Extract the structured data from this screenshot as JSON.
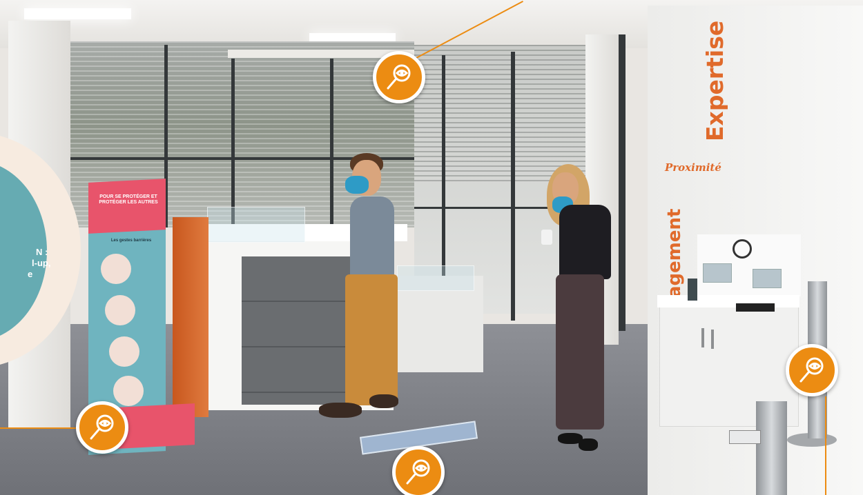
{
  "info_panel": {
    "lines": [
      "N :",
      "l-up,",
      "e"
    ],
    "colors": {
      "outer": "#f7ebe0",
      "inner": "#66abb2"
    }
  },
  "wall_words": {
    "vertical_main": "Expertise",
    "horizontal": "Proximité",
    "vertical_partial": "agement"
  },
  "rollup_banner": {
    "heading": "POUR SE PROTÉGER ET PROTÉGER LES AUTRES",
    "subheading": "Les gestes barrières"
  },
  "hotspots": [
    {
      "id": "hotspot-window",
      "icon": "magnifier-eye-icon"
    },
    {
      "id": "hotspot-rollup",
      "icon": "magnifier-eye-icon"
    },
    {
      "id": "hotspot-floor-sticker",
      "icon": "magnifier-eye-icon"
    },
    {
      "id": "hotspot-dispenser",
      "icon": "magnifier-eye-icon"
    }
  ],
  "colors": {
    "hotspot": "#ec8c12",
    "accent_orange": "#e06a2b",
    "banner_teal": "#6fb4bf",
    "banner_pink": "#e8546b"
  }
}
